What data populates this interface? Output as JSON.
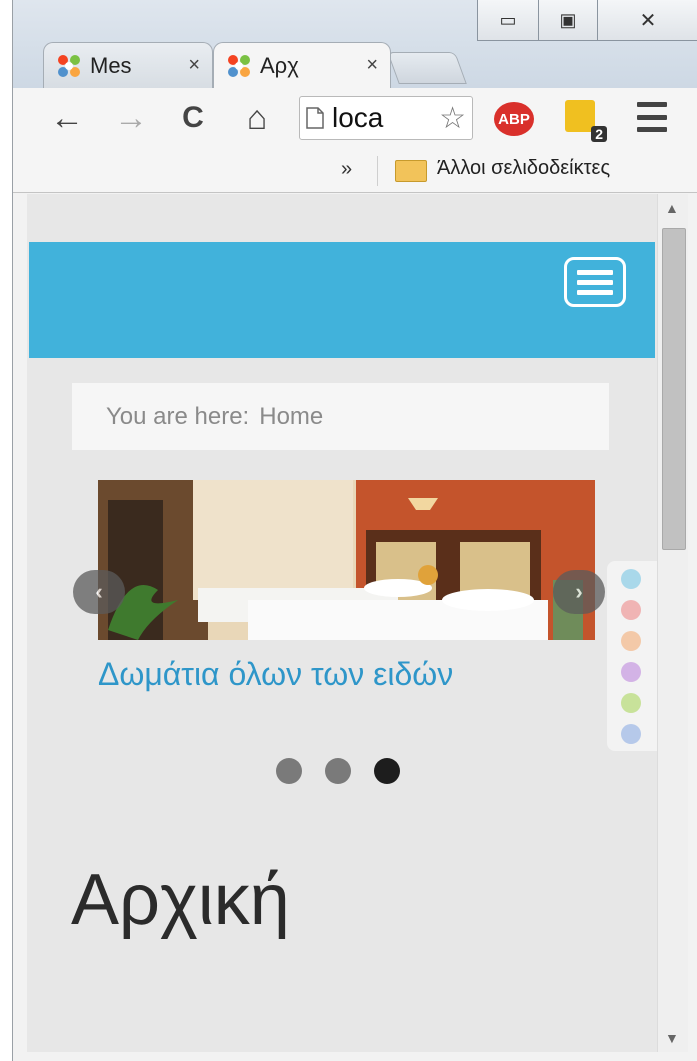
{
  "browser": {
    "tabs": [
      {
        "label": "Mes",
        "close": "×",
        "active": false
      },
      {
        "label": "Αρχ",
        "close": "×",
        "active": true
      }
    ],
    "window_controls": {
      "minimize": "▭",
      "maximize": "▣",
      "close": "✕"
    },
    "toolbar": {
      "back": "←",
      "forward": "→",
      "reload": "C",
      "home": "⌂",
      "url": "loca",
      "star": "☆",
      "abp_label": "ABP",
      "extension_badge": "2"
    },
    "bookmarks": {
      "overflow": "»",
      "other_bookmarks": "Άλλοι σελιδοδείκτες"
    }
  },
  "page": {
    "breadcrumb": {
      "prefix": "You are here:",
      "current": "Home"
    },
    "slider": {
      "caption": "Δωμάτια όλων των ειδών",
      "prev": "‹",
      "next": "›",
      "dots": [
        {
          "active": false
        },
        {
          "active": false
        },
        {
          "active": true
        }
      ]
    },
    "title": "Αρχική",
    "style_swatches": [
      "#a9d8ea",
      "#f0b4b4",
      "#f3c9a8",
      "#d3b3e6",
      "#c8e29a",
      "#b6c9ea"
    ],
    "header_color": "#41b2db"
  }
}
